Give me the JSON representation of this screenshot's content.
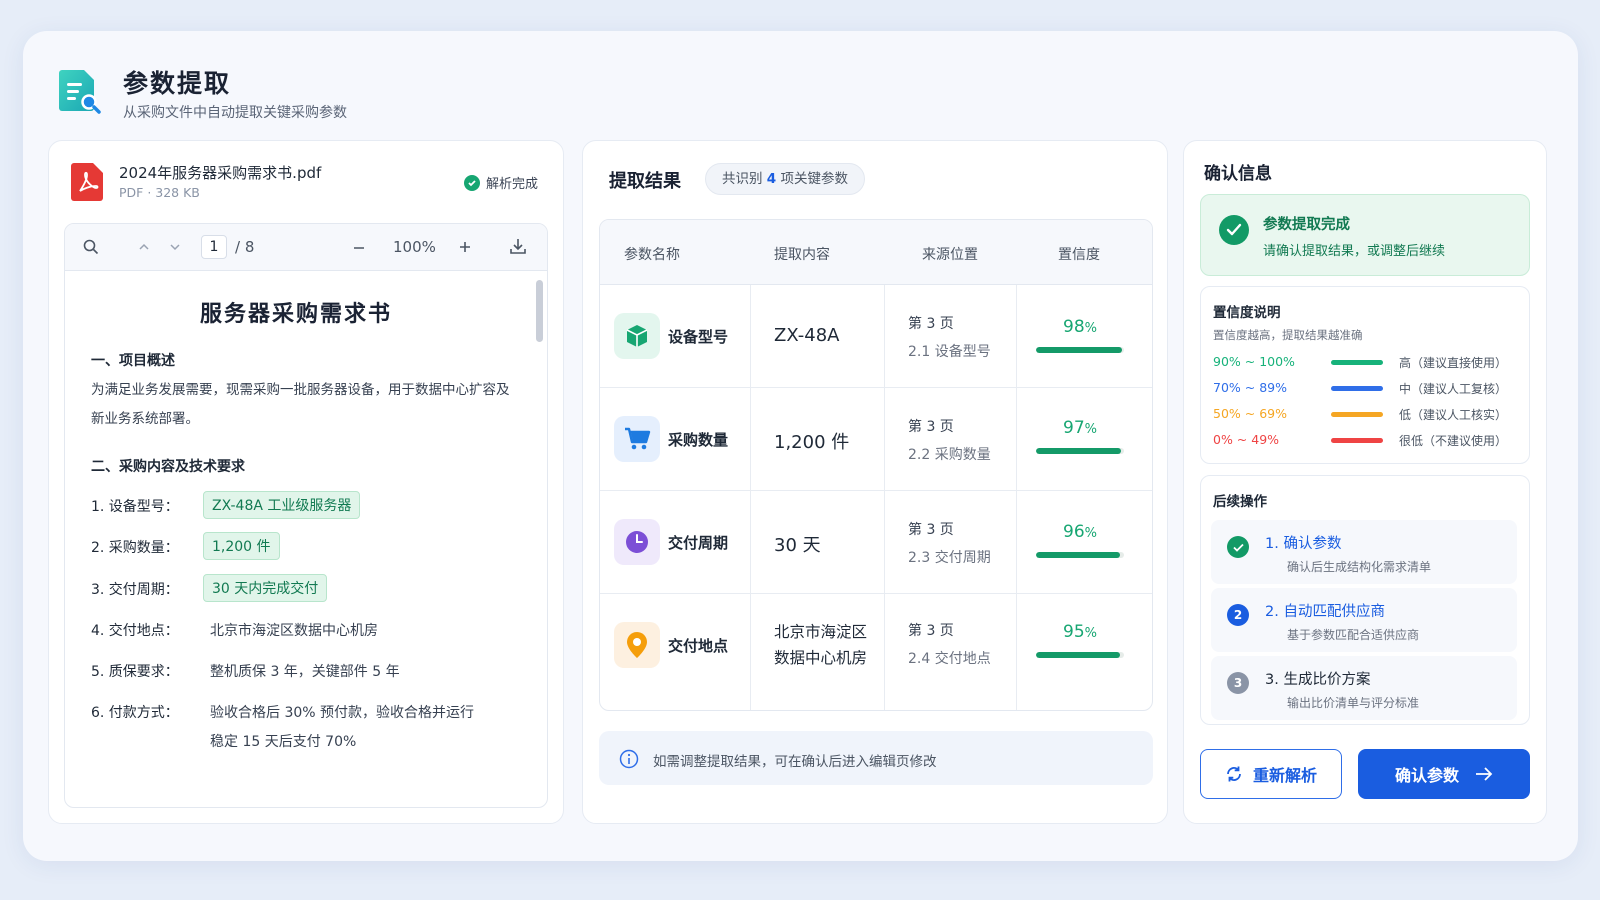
{
  "header": {
    "title": "参数提取",
    "subtitle": "从采购文件中自动提取关键采购参数"
  },
  "file": {
    "name": "2024年服务器采购需求书.pdf",
    "meta": "PDF · 328 KB",
    "status": "解析完成"
  },
  "viewer": {
    "current_page": "1",
    "total_pages": "/ 8",
    "zoom": "100%",
    "doc_title": "服务器采购需求书",
    "section1_title": "一、项目概述",
    "section1_text": "为满足业务发展需要，现需采购一批服务器设备，用于数据中心扩容及新业务系统部署。",
    "section2_title": "二、采购内容及技术要求",
    "items": [
      {
        "label": "1. 设备型号：",
        "value": "ZX-48A 工业级服务器",
        "highlighted": true
      },
      {
        "label": "2. 采购数量：",
        "value": "1,200 件",
        "highlighted": true
      },
      {
        "label": "3. 交付周期：",
        "value": "30 天内完成交付",
        "highlighted": true
      },
      {
        "label": "4. 交付地点：",
        "value": "北京市海淀区数据中心机房",
        "highlighted": false
      },
      {
        "label": "5. 质保要求：",
        "value": "整机质保 3 年，关键部件 5 年",
        "highlighted": false
      },
      {
        "label": "6. 付款方式：",
        "value": "验收合格后 30% 预付款，验收合格并运行",
        "value2": "稳定 15 天后支付 70%",
        "highlighted": false
      }
    ]
  },
  "results": {
    "title": "提取结果",
    "badge_prefix": "共识别",
    "badge_count": "4",
    "badge_suffix": "项关键参数",
    "columns": [
      "参数名称",
      "提取内容",
      "来源位置",
      "置信度"
    ],
    "rows": [
      {
        "icon": "cube-icon",
        "name": "设备型号",
        "value": "ZX-48A",
        "page": "第 3 页",
        "section": "2.1 设备型号",
        "confidence": 98
      },
      {
        "icon": "cart-icon",
        "name": "采购数量",
        "value": "1,200 件",
        "page": "第 3 页",
        "section": "2.2 采购数量",
        "confidence": 97
      },
      {
        "icon": "clock-icon",
        "name": "交付周期",
        "value": "30 天",
        "page": "第 3 页",
        "section": "2.3 交付周期",
        "confidence": 96
      },
      {
        "icon": "location-pin-icon",
        "name": "交付地点",
        "value": "北京市海淀区",
        "value2": "数据中心机房",
        "page": "第 3 页",
        "section": "2.4 交付地点",
        "confidence": 95
      }
    ],
    "note": "如需调整提取结果，可在确认后进入编辑页修改"
  },
  "confirm": {
    "title": "确认信息",
    "success_title": "参数提取完成",
    "success_sub": "请确认提取结果，或调整后继续",
    "legend_title": "置信度说明",
    "legend_sub": "置信度越高，提取结果越准确",
    "legend": [
      {
        "range": "90% ~ 100%",
        "text": "高（建议直接使用）",
        "color": "#17b27a"
      },
      {
        "range": "70% ~ 89%",
        "text": "中（建议人工复核）",
        "color": "#2f6ee8"
      },
      {
        "range": "50% ~ 69%",
        "text": "低（建议人工核实）",
        "color": "#f5a623"
      },
      {
        "range": "0% ~ 49%",
        "text": "很低（不建议使用）",
        "color": "#ef4444"
      }
    ],
    "steps_title": "后续操作",
    "steps": [
      {
        "title": "1. 确认参数",
        "sub": "确认后生成结构化需求清单",
        "state": "done"
      },
      {
        "title": "2. 自动匹配供应商",
        "sub": "基于参数匹配合适供应商",
        "state": "active",
        "num": "2"
      },
      {
        "title": "3. 生成比价方案",
        "sub": "输出比价清单与评分标准",
        "state": "pending",
        "num": "3"
      }
    ],
    "reparse_label": "重新解析",
    "confirm_label": "确认参数"
  }
}
